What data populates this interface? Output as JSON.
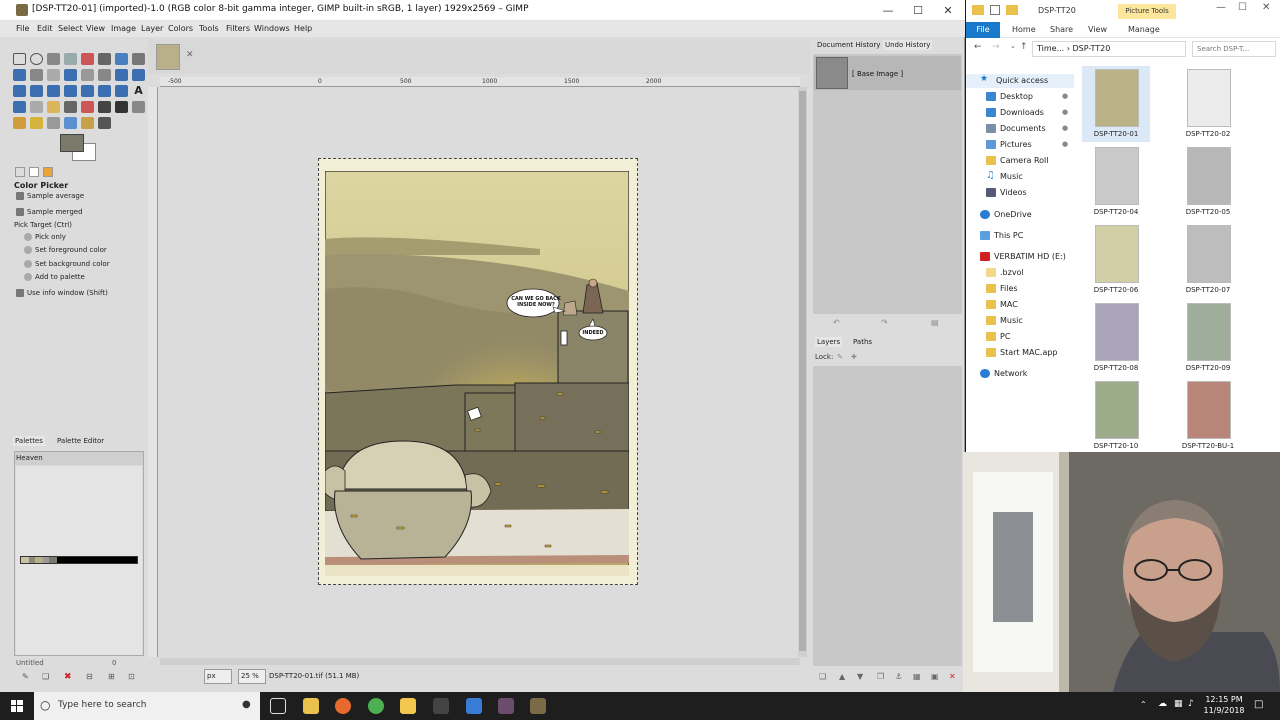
{
  "gimp": {
    "title": "[DSP-TT20-01] (imported)-1.0 (RGB color 8-bit gamma integer, GIMP built-in sRGB, 1 layer) 1929x2569 – GIMP",
    "menu": [
      "File",
      "Edit",
      "Select",
      "View",
      "Image",
      "Layer",
      "Colors",
      "Tools",
      "Filters",
      "Windows",
      "Help"
    ],
    "tool_options": {
      "title": "Color Picker",
      "sample_average": "Sample average",
      "sample_merged": "Sample merged",
      "pick_target": "Pick Target  (Ctrl)",
      "pick_only": "Pick only",
      "set_fg": "Set foreground color",
      "set_bg": "Set background color",
      "add_palette": "Add to palette",
      "use_info": "Use info window  (Shift)"
    },
    "palettes": {
      "tab_palettes": "Palettes",
      "tab_editor": "Palette Editor",
      "name": "Heaven",
      "footer_name": "Untitled",
      "footer_count": "0"
    },
    "rulers": {
      "h0": "0",
      "h500": "500",
      "h1000": "1000",
      "h1500": "1500",
      "h2000": "2000",
      "h-500": "-500"
    },
    "status": {
      "unit": "px",
      "zoom": "25 %",
      "text": "DSP-TT20-01.tif (51.1 MB)"
    },
    "history": {
      "tab_doc": "Document History",
      "tab_undo": "Undo History",
      "item": "[ Base Image ]"
    },
    "layers": {
      "tab_layers": "Layers",
      "tab_paths": "Paths",
      "lock": "Lock:"
    },
    "comic": {
      "bubble1": "CAN WE GO BACK INSIDE NOW?",
      "bubble2": "INDEED"
    }
  },
  "explorer": {
    "title": "DSP-TT20",
    "picture_tools": "Picture Tools",
    "ribbon": [
      "File",
      "Home",
      "Share",
      "View",
      "Manage"
    ],
    "address": "Time...  ›  DSP-TT20",
    "search_placeholder": "Search DSP-T...",
    "nav": [
      {
        "label": "Quick access"
      },
      {
        "label": "Desktop"
      },
      {
        "label": "Downloads"
      },
      {
        "label": "Documents"
      },
      {
        "label": "Pictures"
      },
      {
        "label": "Camera Roll"
      },
      {
        "label": "Music"
      },
      {
        "label": "Videos"
      },
      {
        "label": "OneDrive"
      },
      {
        "label": "This PC"
      },
      {
        "label": "VERBATIM HD (E:)"
      },
      {
        "label": ".bzvol"
      },
      {
        "label": "Files"
      },
      {
        "label": "MAC"
      },
      {
        "label": "Music"
      },
      {
        "label": "PC"
      },
      {
        "label": "Start MAC.app"
      },
      {
        "label": "Network"
      }
    ],
    "files": [
      {
        "name": "DSP-TT20-01"
      },
      {
        "name": "DSP-TT20-02"
      },
      {
        "name": "DSP-TT20-04"
      },
      {
        "name": "DSP-TT20-05"
      },
      {
        "name": "DSP-TT20-06"
      },
      {
        "name": "DSP-TT20-07"
      },
      {
        "name": "DSP-TT20-08"
      },
      {
        "name": "DSP-TT20-09"
      },
      {
        "name": "DSP-TT20-10"
      },
      {
        "name": "DSP-TT20-BU-1"
      }
    ]
  },
  "taskbar": {
    "search_placeholder": "Type here to search",
    "time": "12:15 PM",
    "date": "11/9/2018"
  },
  "colors": {
    "accent": "#1979ca",
    "picture_tools": "#fbe69b",
    "canvas_bg": "#dcdcdc"
  }
}
